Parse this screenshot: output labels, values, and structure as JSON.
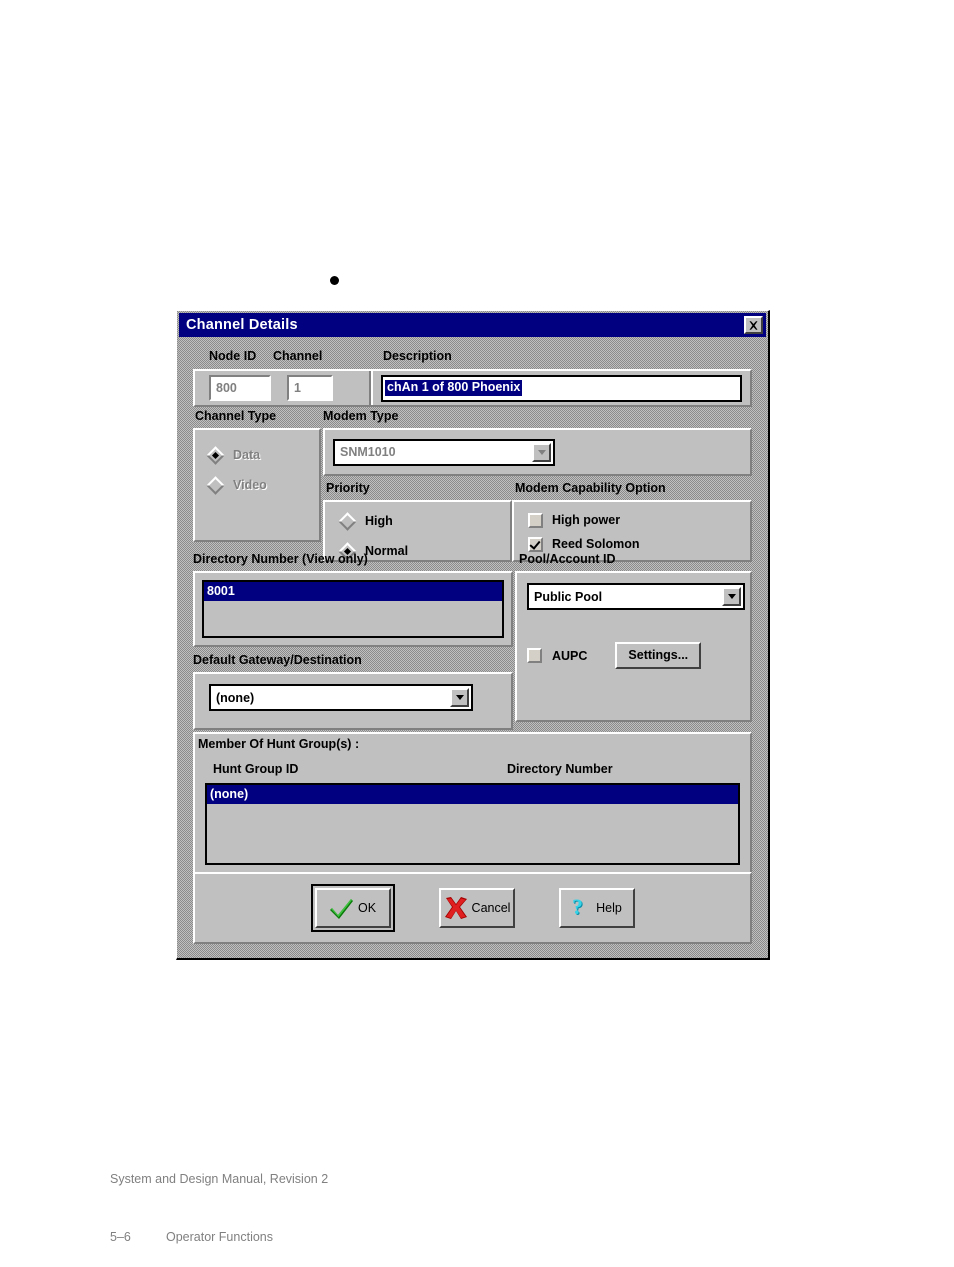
{
  "dialog": {
    "title": "Channel Details",
    "close_icon": "close-icon"
  },
  "identity": {
    "node_id_label": "Node ID",
    "channel_label": "Channel",
    "description_label": "Description",
    "node_id_value": "800",
    "channel_value": "1",
    "description_value": "chAn 1 of 800 Phoenix"
  },
  "channel_type": {
    "label": "Channel Type",
    "options": [
      {
        "label": "Data",
        "selected": true,
        "disabled": true
      },
      {
        "label": "Video",
        "selected": false,
        "disabled": true
      }
    ]
  },
  "modem_type": {
    "label": "Modem Type",
    "value": "SNM1010",
    "disabled": true
  },
  "priority": {
    "label": "Priority",
    "options": [
      {
        "label": "High",
        "selected": false
      },
      {
        "label": "Normal",
        "selected": true
      }
    ]
  },
  "modem_capability": {
    "label": "Modem Capability Option",
    "options": [
      {
        "label": "High power",
        "checked": false
      },
      {
        "label": "Reed Solomon",
        "checked": true
      }
    ]
  },
  "directory_number": {
    "label": "Directory Number (View only)",
    "rows": [
      "8001"
    ]
  },
  "default_gateway": {
    "label": "Default Gateway/Destination",
    "value": "(none)"
  },
  "pool_account": {
    "label": "Pool/Account ID",
    "value": "Public Pool",
    "aupc_label": "AUPC",
    "aupc_checked": false,
    "settings_label": "Settings..."
  },
  "hunt_group": {
    "label": "Member Of Hunt Group(s) :",
    "columns": [
      "Hunt Group ID",
      "Directory Number"
    ],
    "rows": [
      {
        "hunt_group_id": "(none)",
        "directory_number": ""
      }
    ]
  },
  "buttons": {
    "ok": "OK",
    "cancel": "Cancel",
    "help": "Help"
  },
  "footer": {
    "line1": "System and Design Manual, Revision 2",
    "page": "5–6",
    "section": "Operator Functions"
  },
  "colors": {
    "titlebar": "#000080",
    "face": "#c0c0c0",
    "selection": "#000080",
    "disabled_text": "#808080",
    "ok_check": "#00a000",
    "cancel_x": "#c00000",
    "help_question": "#00b0c8"
  }
}
